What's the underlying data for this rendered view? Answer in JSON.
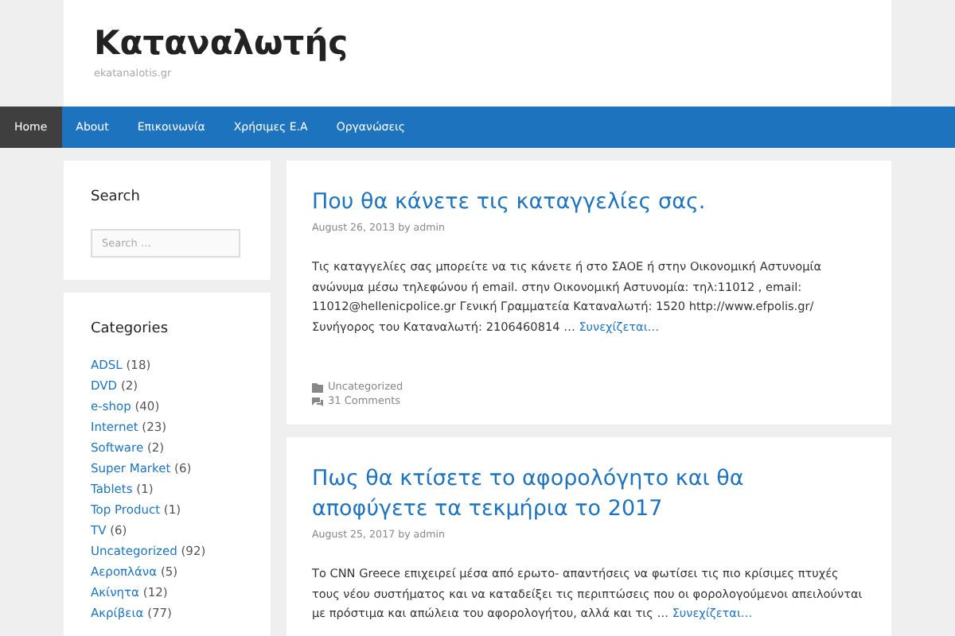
{
  "site": {
    "title": "Καταναλωτής",
    "tagline": "ekatanalotis.gr"
  },
  "nav": [
    {
      "label": "Home",
      "selected": true
    },
    {
      "label": "About",
      "selected": false
    },
    {
      "label": "Επικοινωνία",
      "selected": false
    },
    {
      "label": "Χρήσιμες Ε.Α",
      "selected": false
    },
    {
      "label": "Οργανώσεις",
      "selected": false
    }
  ],
  "search_widget": {
    "title": "Search",
    "placeholder": "Search …"
  },
  "categories": {
    "title": "Categories",
    "items": [
      {
        "name": "ADSL",
        "count": "(18)"
      },
      {
        "name": "DVD",
        "count": "(2)"
      },
      {
        "name": "e-shop",
        "count": "(40)"
      },
      {
        "name": "Internet",
        "count": "(23)"
      },
      {
        "name": "Software",
        "count": "(2)"
      },
      {
        "name": "Super Market",
        "count": "(6)"
      },
      {
        "name": "Tablets",
        "count": "(1)"
      },
      {
        "name": "Top Product",
        "count": "(1)"
      },
      {
        "name": "TV",
        "count": "(6)"
      },
      {
        "name": "Uncategorized",
        "count": "(92)"
      },
      {
        "name": "Αεροπλάνα",
        "count": "(5)"
      },
      {
        "name": "Ακίνητα",
        "count": "(12)"
      },
      {
        "name": "Ακρίβεια",
        "count": "(77)"
      }
    ]
  },
  "posts": [
    {
      "title": "Που θα κάνετε τις καταγγελίες σας.",
      "meta": "August 26, 2013 by admin",
      "excerpt": "Τις καταγγελίες σας μπορείτε να τις κάνετε ή στο ΣΑΟΕ ή στην Οικονομική Αστυνομία ανώνυμα μέσω τηλεφώνου ή email. στην Οικονομική Αστυνομία: τηλ:11012 , email: 11012@hellenicpolice.gr Γενική Γραμματεία Καταναλωτή: 1520 http://www.efpolis.gr/ Συνήγορος του Καταναλωτή: 2106460814 …",
      "more": "Συνεχίζεται…",
      "category": "Uncategorized",
      "comments": "31 Comments"
    },
    {
      "title": "Πως θα κτίσετε το αφορολόγητο και θα αποφύγετε τα τεκμήρια το 2017",
      "meta": "August 25, 2017 by admin",
      "excerpt": "Το CNN Greece επιχειρεί μέσα από ερωτο- απαντήσεις να φωτίσει τις πιο κρίσιμες πτυχές τους νέου συστήματος και να καταδείξει τις περιπτώσεις που οι φορολογούμενοι απειλούνται με πρόστιμα και απώλεια του αφορολογήτου, αλλά και τις …",
      "more": "Συνεχίζεται…"
    }
  ]
}
